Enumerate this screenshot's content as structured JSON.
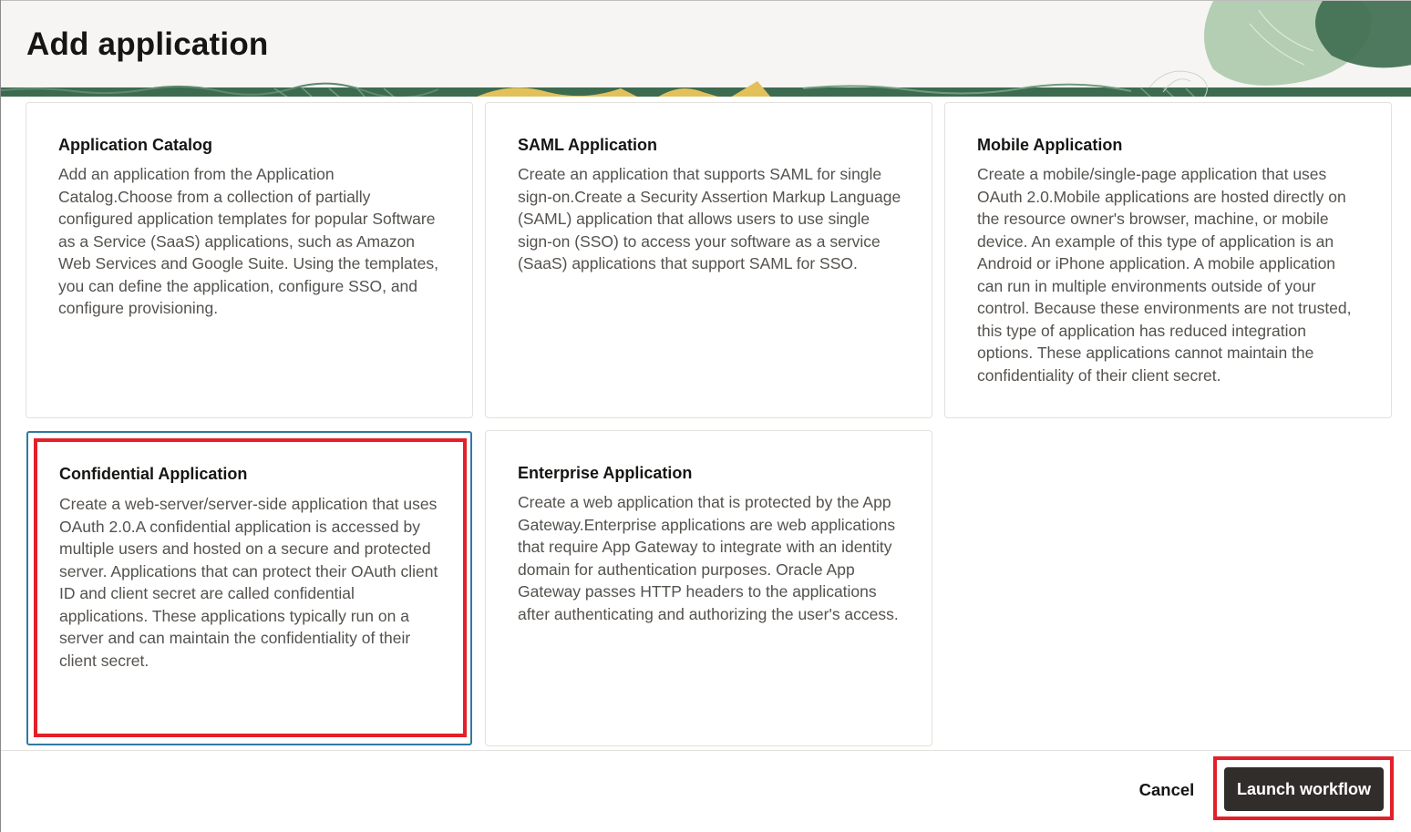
{
  "dialog": {
    "title": "Add application"
  },
  "cards": [
    {
      "title": "Application Catalog",
      "description": "Add an application from the Application Catalog.Choose from a collection of partially configured application templates for popular Software as a Service (SaaS) applications, such as Amazon Web Services and Google Suite. Using the templates, you can define the application, configure SSO, and configure provisioning.",
      "selected": false
    },
    {
      "title": "SAML Application",
      "description": "Create an application that supports SAML for single sign-on.Create a Security Assertion Markup Language (SAML) application that allows users to use single sign-on (SSO) to access your software as a service (SaaS) applications that support SAML for SSO.",
      "selected": false
    },
    {
      "title": "Mobile Application",
      "description": "Create a mobile/single-page application that uses OAuth 2.0.Mobile applications are hosted directly on the resource owner's browser, machine, or mobile device. An example of this type of application is an Android or iPhone application. A mobile application can run in multiple environments outside of your control. Because these environments are not trusted, this type of application has reduced integration options. These applications cannot maintain the confidentiality of their client secret.",
      "selected": false
    },
    {
      "title": "Confidential Application",
      "description": "Create a web-server/server-side application that uses OAuth 2.0.A confidential application is accessed by multiple users and hosted on a secure and protected server. Applications that can protect their OAuth client ID and client secret are called confidential applications. These applications typically run on a server and can maintain the confidentiality of their client secret.",
      "selected": true
    },
    {
      "title": "Enterprise Application",
      "description": "Create a web application that is protected by the App Gateway.Enterprise applications are web applications that require App Gateway to integrate with an identity domain for authentication purposes. Oracle App Gateway passes HTTP headers to the applications after authenticating and authorizing the user's access.",
      "selected": false
    }
  ],
  "footer": {
    "cancel_label": "Cancel",
    "launch_label": "Launch workflow"
  },
  "colors": {
    "selected_border": "#2f7aa0",
    "highlight_annotation": "#e3202a",
    "primary_button": "#312d2a",
    "header_green": "#3d6b4f",
    "header_yellow": "#e3c15a"
  }
}
